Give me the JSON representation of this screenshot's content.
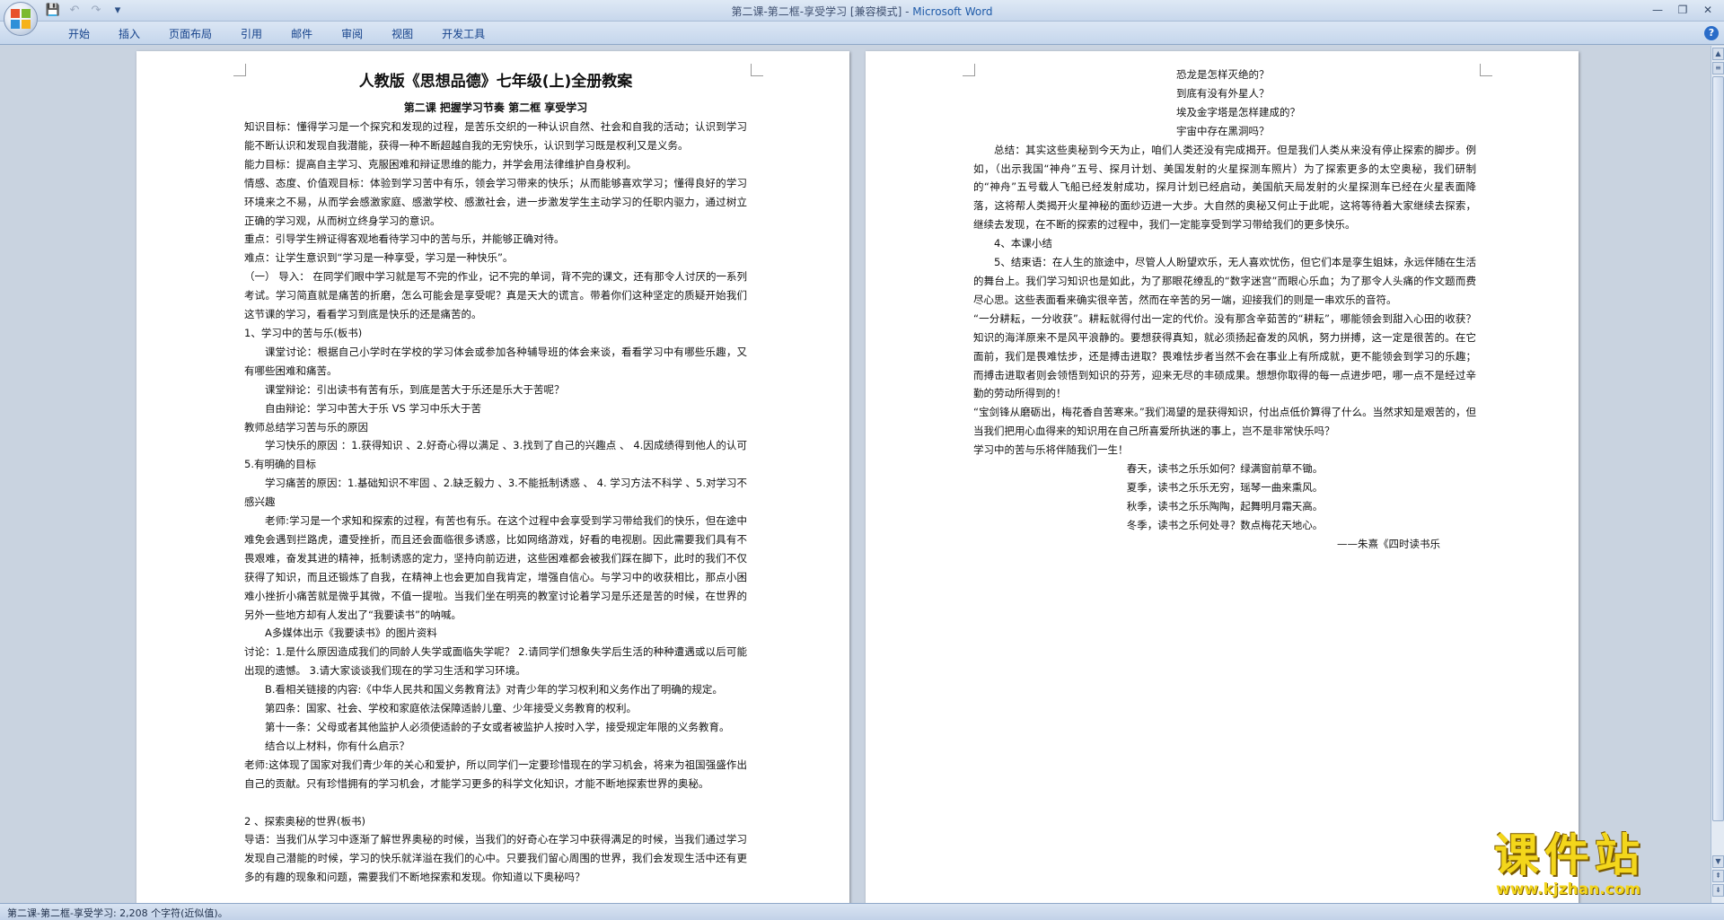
{
  "window": {
    "title_doc": "第二课-第二框-享受学习 [兼容模式] - ",
    "title_app": "Microsoft Word"
  },
  "qat": {
    "save": "💾",
    "undo": "↶",
    "redo": "↷",
    "customize": "▾"
  },
  "ribbon": {
    "tabs": [
      "开始",
      "插入",
      "页面布局",
      "引用",
      "邮件",
      "审阅",
      "视图",
      "开发工具"
    ]
  },
  "left_page": {
    "title": "人教版《思想品德》七年级(上)全册教案",
    "subtitle": "第二课  把握学习节奏  第二框  享受学习",
    "paragraphs": [
      "知识目标：懂得学习是一个探究和发现的过程，是苦乐交织的一种认识自然、社会和自我的活动；认识到学习能不断认识和发现自我潜能，获得一种不断超越自我的无穷快乐，认识到学习既是权利又是义务。",
      "能力目标：提高自主学习、克服困难和辩证思维的能力，并学会用法律维护自身权利。",
      "情感、态度、价值观目标：体验到学习苦中有乐，领会学习带来的快乐；从而能够喜欢学习；懂得良好的学习环境来之不易，从而学会感激家庭、感激学校、感激社会，进一步激发学生主动学习的任职内驱力，通过树立正确的学习观，从而树立终身学习的意识。",
      "重点：引导学生辨证得客观地看待学习中的苦与乐，并能够正确对待。",
      "难点：让学生意识到“学习是一种享受，学习是一种快乐”。",
      "（一）  导入：  在同学们眼中学习就是写不完的作业，记不完的单词，背不完的课文，还有那令人讨厌的一系列考试。学习简直就是痛苦的折磨，怎么可能会是享受呢？真是天大的谎言。带着你们这种坚定的质疑开始我们这节课的学习，看看学习到底是快乐的还是痛苦的。",
      "1、学习中的苦与乐(板书)",
      "课堂讨论：根据自己小学时在学校的学习体会或参加各种辅导班的体会来谈，看看学习中有哪些乐趣，又有哪些困难和痛苦。",
      "课堂辩论：引出读书有苦有乐，到底是苦大于乐还是乐大于苦呢？",
      "自由辩论：学习中苦大于乐 VS 学习中乐大于苦",
      "教师总结学习苦与乐的原因",
      "学习快乐的原因  ：1.获得知识 、2.好奇心得以满足 、3.找到了自己的兴趣点  、  4.因成绩得到他人的认可 5.有明确的目标",
      "学习痛苦的原因：1.基础知识不牢固  、2.缺乏毅力 、3.不能抵制诱惑    、  4. 学习方法不科学 、5.对学习不感兴趣",
      "老师:学习是一个求知和探索的过程，有苦也有乐。在这个过程中会享受到学习带给我们的快乐，但在途中难免会遇到拦路虎，遭受挫折，而且还会面临很多诱惑，比如网络游戏，好看的电视剧。因此需要我们具有不畏艰难，奋发其进的精神，抵制诱惑的定力，坚持向前迈进，这些困难都会被我们踩在脚下，此时的我们不仅获得了知识，而且还锻炼了自我，在精神上也会更加自我肯定，增强自信心。与学习中的收获相比，那点小困难小挫折小痛苦就是微乎其微，不值一提啦。当我们坐在明亮的教室讨论着学习是乐还是苦的时候，在世界的另外一些地方却有人发出了“我要读书”的呐喊。",
      "A多媒体出示《我要读书》的图片资料",
      "讨论：1.是什么原因造成我们的同龄人失学或面临失学呢？ 2.请同学们想象失学后生活的种种遭遇或以后可能出现的遗憾。 3.请大家谈谈我们现在的学习生活和学习环境。",
      "B.看相关链接的内容:《中华人民共和国义务教育法》对青少年的学习权利和义务作出了明确的规定。",
      "第四条：国家、社会、学校和家庭依法保障适龄儿童、少年接受义务教育的权利。",
      "第十一条：父母或者其他监护人必须使适龄的子女或者被监护人按时入学，接受规定年限的义务教育。",
      "结合以上材料，你有什么启示？",
      "老师:这体现了国家对我们青少年的关心和爱护，所以同学们一定要珍惜现在的学习机会，将来为祖国强盛作出自己的贡献。只有珍惜拥有的学习机会，才能学习更多的科学文化知识，才能不断地探索世界的奥秘。",
      "",
      "2 、探索奥秘的世界(板书)",
      "导语：当我们从学习中逐渐了解世界奥秘的时候，当我们的好奇心在学习中获得满足的时候，当我们通过学习发现自己潜能的时候，学习的快乐就洋溢在我们的心中。只要我们留心周围的世界，我们会发现生活中还有更多的有趣的现象和问题，需要我们不断地探索和发现。你知道以下奥秘吗？"
    ]
  },
  "right_page": {
    "questions": [
      "恐龙是怎样灭绝的？",
      "到底有没有外星人？",
      "埃及金字塔是怎样建成的？",
      "宇宙中存在黑洞吗？"
    ],
    "paragraphs": [
      "总结：其实这些奥秘到今天为止，咱们人类还没有完成揭开。但是我们人类从来没有停止探索的脚步。例如，（出示我国“神舟”五号、探月计划、美国发射的火星探测车照片）为了探索更多的太空奥秘，我们研制的“神舟”五号载人飞船已经发射成功，探月计划已经启动，美国航天局发射的火星探测车已经在火星表面降落，这将帮人类揭开火星神秘的面纱迈进一大步。大自然的奥秘又何止于此呢，这将等待着大家继续去探索，继续去发现，在不断的探索的过程中，我们一定能享受到学习带给我们的更多快乐。",
      "4、本课小结",
      "5、结束语：在人生的旅途中，尽管人人盼望欢乐，无人喜欢忧伤，但它们本是孪生姐妹，永远伴随在生活的舞台上。我们学习知识也是如此，为了那眼花缭乱的“数字迷宫”而眼心乐血；为了那令人头痛的作文题而费尽心思。这些表面看来确实很辛苦，然而在辛苦的另一端，迎接我们的则是一串欢乐的音符。",
      "“一分耕耘，一分收获”。耕耘就得付出一定的代价。没有那含辛茹苦的“耕耘”，哪能领会到甜入心田的收获？知识的海洋原来不是风平浪静的。要想获得真知，就必须扬起奋发的风帆，努力拼搏，这一定是很苦的。在它面前，我们是畏难怯步，还是搏击进取？畏难怯步者当然不会在事业上有所成就，更不能领会到学习的乐趣；而搏击进取者则会领悟到知识的芬芳，迎来无尽的丰硕成果。想想你取得的每一点进步吧，哪一点不是经过辛勤的劳动所得到的！",
      "“宝剑锋从磨砺出，梅花香自苦寒来。”我们渴望的是获得知识，付出点低价算得了什么。当然求知是艰苦的，但当我们把用心血得来的知识用在自己所喜爱所执迷的事上，岂不是非常快乐吗？",
      "学习中的苦与乐将伴随我们一生！"
    ],
    "poem": [
      "春天，读书之乐乐如何？绿满窗前草不锄。",
      "夏季，读书之乐乐无穷，瑶琴一曲来熏风。",
      "秋季，读书之乐乐陶陶，起舞明月霜天高。",
      "冬季，读书之乐何处寻？数点梅花天地心。"
    ],
    "poem_attribution": "——朱熹《四时读书乐"
  },
  "status": {
    "text": "第二课-第二框-享受学习: 2,208 个字符(近似值)。"
  },
  "watermark": {
    "main": "课件站",
    "url": "www.kjzhan.com"
  },
  "colors": {
    "accent": "#1e5aa8",
    "watermark": "#f3d61b",
    "workspace": "#c9d3e0"
  }
}
